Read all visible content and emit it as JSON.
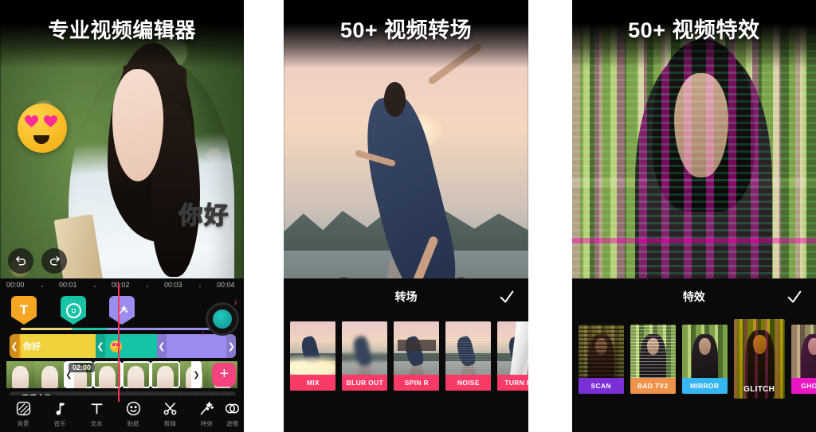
{
  "panels": [
    {
      "id": "editor",
      "headline": "专业视频编辑器",
      "overlay_text": "你好",
      "sticker": "heart-eyes-emoji",
      "undo_label": "undo",
      "redo_label": "redo",
      "timeline": {
        "ruler_ticks": [
          "00:00",
          "00:01",
          "00:02",
          "00:03",
          "00:04"
        ],
        "playhead_time": "00:02",
        "markers": [
          {
            "type": "text",
            "glyph": "T",
            "color": "#f5a623"
          },
          {
            "type": "sticker",
            "glyph": "☺",
            "color": "#17c2a5"
          },
          {
            "type": "effect",
            "glyph": "✦",
            "color": "#9b8cf0"
          }
        ],
        "tracks": [
          {
            "name": "text-clip",
            "label": "你好",
            "color": "#f0d33c"
          },
          {
            "name": "sticker-clip",
            "label": "",
            "color": "#16c3a4"
          },
          {
            "name": "effect-clip",
            "label": "",
            "color": "#9b8cf0"
          }
        ],
        "clip_duration_badge": "02:00",
        "music_track_label": "音乐合集",
        "add_clip_label": "+"
      },
      "toolbar": [
        {
          "icon": "background-icon",
          "label": "背景"
        },
        {
          "icon": "music-icon",
          "label": "音乐"
        },
        {
          "icon": "text-icon",
          "label": "文本"
        },
        {
          "icon": "sticker-icon",
          "label": "贴纸"
        },
        {
          "icon": "trim-icon",
          "label": "剪辑"
        },
        {
          "icon": "effects-icon",
          "label": "特效"
        },
        {
          "icon": "filter-icon",
          "label": "滤镜"
        }
      ]
    },
    {
      "id": "transitions",
      "headline": "50+ 视频转场",
      "sheet_title": "转场",
      "confirm_icon": "check-icon",
      "items": [
        {
          "label": "MIX",
          "accent": "#fb3b67"
        },
        {
          "label": "BLUR OUT",
          "accent": "#fb3b67"
        },
        {
          "label": "SPIN R",
          "accent": "#fb3b67"
        },
        {
          "label": "NOISE",
          "accent": "#fb3b67"
        },
        {
          "label": "TURN PA",
          "accent": "#fb3b67"
        }
      ]
    },
    {
      "id": "effects",
      "headline": "50+ 视频特效",
      "sheet_title": "特效",
      "confirm_icon": "check-icon",
      "items": [
        {
          "label": "SCAN",
          "accent": "#7b2fd6",
          "selected": false
        },
        {
          "label": "BAD TV2",
          "accent": "#f0934a",
          "selected": false
        },
        {
          "label": "MIRROR",
          "accent": "#36b6f0",
          "selected": false
        },
        {
          "label": "GLITCH",
          "accent": "#e8b414",
          "selected": true
        },
        {
          "label": "GHOST",
          "accent": "#e916c6",
          "selected": false
        }
      ]
    }
  ],
  "colors": {
    "accent_pink": "#f4437e",
    "playhead": "#ff3355",
    "panel_bg": "#0a0a0a"
  }
}
